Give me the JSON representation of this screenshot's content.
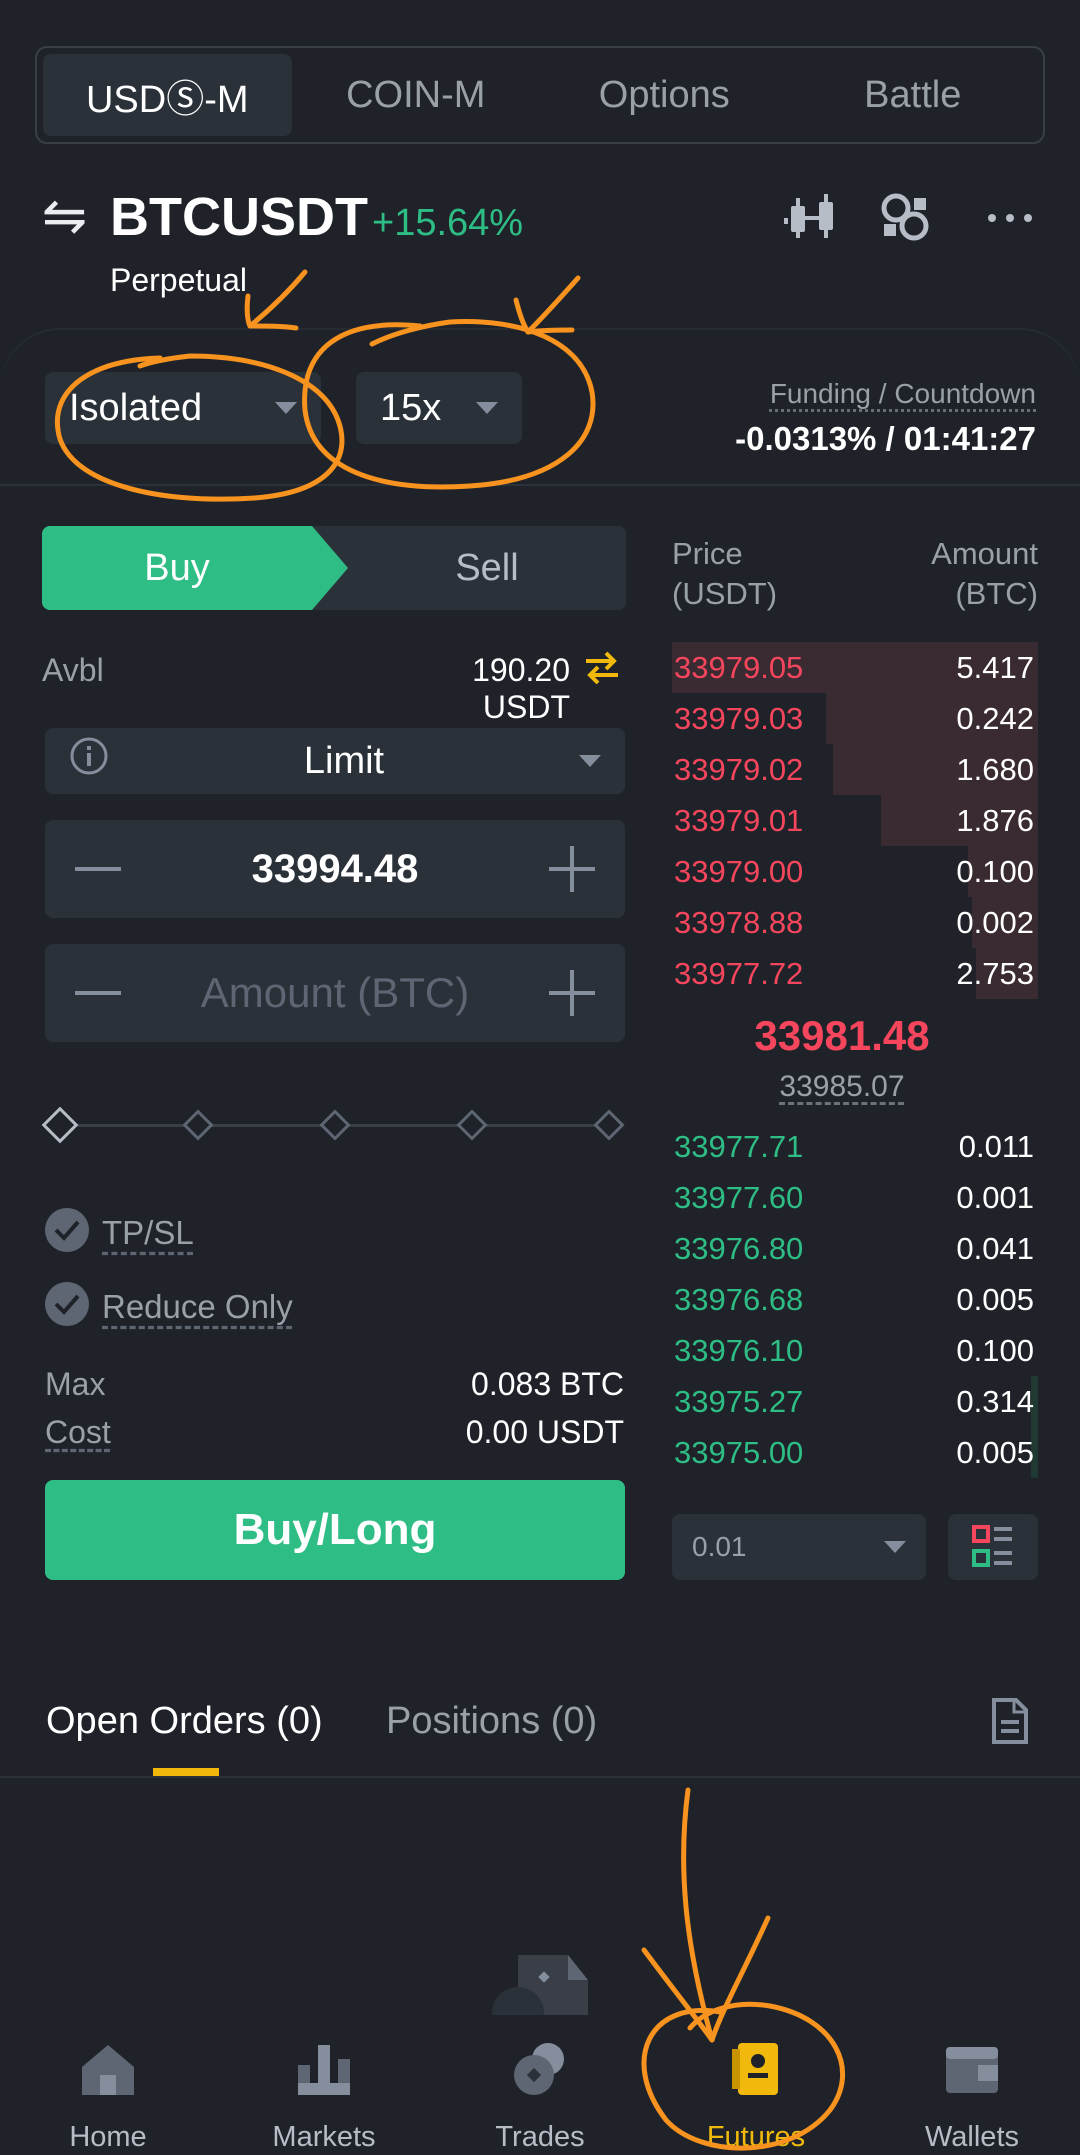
{
  "segment_tabs": [
    "USDⓈ-M",
    "COIN-M",
    "Options",
    "Battle"
  ],
  "header": {
    "pair": "BTCUSDT",
    "change_pct": "+15.64%",
    "subtitle": "Perpetual"
  },
  "margin_mode": "Isolated",
  "leverage": "15x",
  "funding": {
    "label": "Funding / Countdown",
    "value": "-0.0313% / 01:41:27"
  },
  "order_side": {
    "buy": "Buy",
    "sell": "Sell"
  },
  "available": {
    "label": "Avbl",
    "value": "190.20 USDT"
  },
  "order_type": "Limit",
  "price_input": {
    "value": "33994.48"
  },
  "amount_input": {
    "placeholder": "Amount (BTC)"
  },
  "options": {
    "tpsl": "TP/SL",
    "reduce_only": "Reduce Only"
  },
  "max": {
    "label": "Max",
    "value": "0.083 BTC"
  },
  "cost": {
    "label": "Cost",
    "value": "0.00 USDT"
  },
  "submit_label": "Buy/Long",
  "orderbook": {
    "price_header": "Price\n(USDT)",
    "price_header_l1": "Price",
    "price_header_l2": "(USDT)",
    "amount_header_l1": "Amount",
    "amount_header_l2": "(BTC)",
    "asks": [
      {
        "price": "33979.05",
        "amount": "5.417",
        "depth": 1.0
      },
      {
        "price": "33979.03",
        "amount": "0.242",
        "depth": 0.58
      },
      {
        "price": "33979.02",
        "amount": "1.680",
        "depth": 0.56
      },
      {
        "price": "33979.01",
        "amount": "1.876",
        "depth": 0.43
      },
      {
        "price": "33979.00",
        "amount": "0.100",
        "depth": 0.19
      },
      {
        "price": "33978.88",
        "amount": "0.002",
        "depth": 0.18
      },
      {
        "price": "33977.72",
        "amount": "2.753",
        "depth": 0.17
      }
    ],
    "last_price": "33981.48",
    "mark_price": "33985.07",
    "bids": [
      {
        "price": "33977.71",
        "amount": "0.011",
        "depth": 0.0
      },
      {
        "price": "33977.60",
        "amount": "0.001",
        "depth": 0.0
      },
      {
        "price": "33976.80",
        "amount": "0.041",
        "depth": 0.0
      },
      {
        "price": "33976.68",
        "amount": "0.005",
        "depth": 0.0
      },
      {
        "price": "33976.10",
        "amount": "0.100",
        "depth": 0.0
      },
      {
        "price": "33975.27",
        "amount": "0.314",
        "depth": 0.02
      },
      {
        "price": "33975.00",
        "amount": "0.005",
        "depth": 0.02
      }
    ],
    "precision": "0.01"
  },
  "orders_tabs": {
    "open_orders": "Open Orders (0)",
    "positions": "Positions (0)"
  },
  "bottom_nav": [
    "Home",
    "Markets",
    "Trades",
    "Futures",
    "Wallets"
  ],
  "colors": {
    "buy": "#2ebd85",
    "sell": "#f6465d",
    "accent": "#f0b90b",
    "annotation": "#f7931e"
  }
}
